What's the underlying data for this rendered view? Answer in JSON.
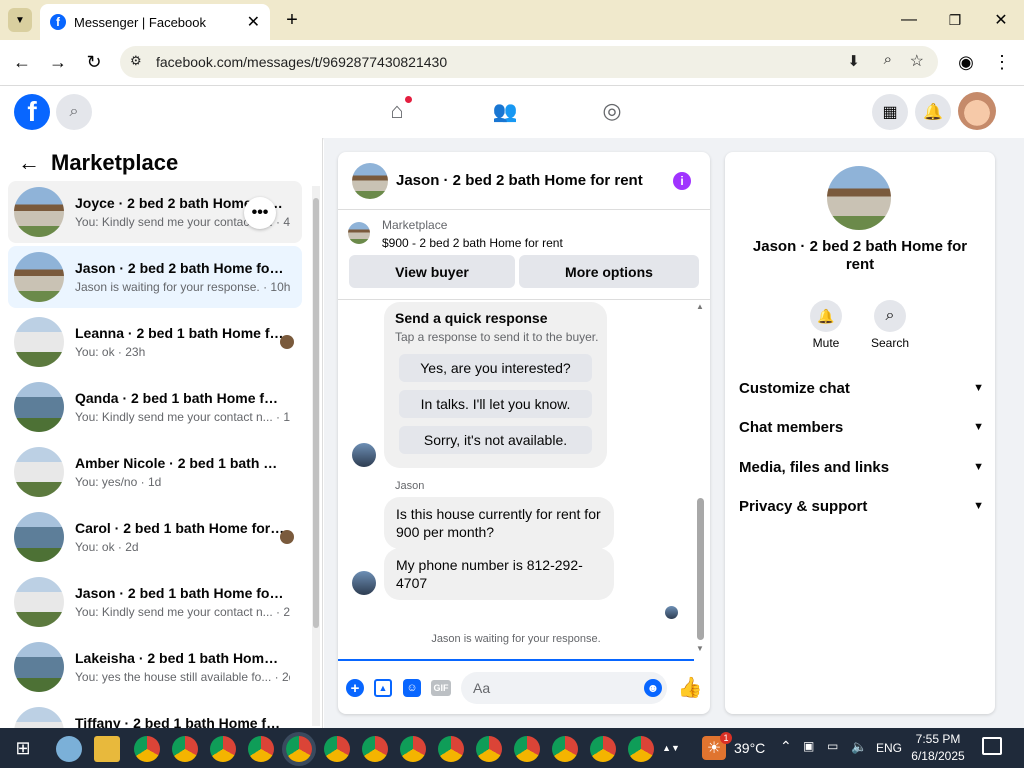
{
  "browser": {
    "tab_title": "Messenger | Facebook",
    "url": "facebook.com/messages/t/9692877430821430"
  },
  "sidebar": {
    "title": "Marketplace",
    "conversations": [
      {
        "name": "Joyce · 2 bed 2 bath Home for rent",
        "preview": "You: Kindly send me your contact n... · 4m",
        "img": "house"
      },
      {
        "name": "Jason · 2 bed 2 bath Home for rent",
        "preview": "Jason is waiting for your response. · 10h",
        "img": "house"
      },
      {
        "name": "Leanna · 2 bed 1 bath Home for rent",
        "preview": "You: ok · 23h",
        "img": "house2"
      },
      {
        "name": "Qanda · 2 bed 1 bath Home for rent",
        "preview": "You: Kindly send me your contact n... · 1d",
        "img": "house3"
      },
      {
        "name": "Amber Nicole · 2 bed 1 bath Home for rent",
        "preview": "You: yes/no · 1d",
        "img": "house2"
      },
      {
        "name": "Carol · 2 bed 1 bath Home for rent",
        "preview": "You: ok · 2d",
        "img": "house3"
      },
      {
        "name": "Jason · 2 bed 1 bath Home for rent",
        "preview": "You: Kindly send me your contact n... · 2d",
        "img": "house2"
      },
      {
        "name": "Lakeisha · 2 bed 1 bath Home for rent",
        "preview": "You: yes the house still available fo... · 2d",
        "img": "house3"
      },
      {
        "name": "Tiffany · 2 bed 1 bath Home for rent",
        "preview": "",
        "img": "house2"
      }
    ]
  },
  "chat": {
    "header_title": "Jason · 2 bed 2 bath Home for rent",
    "listing_source": "Marketplace",
    "listing_title": "$900 - 2 bed 2 bath Home for rent",
    "view_buyer": "View buyer",
    "more_options": "More options",
    "quick_title": "Send a quick response",
    "quick_sub": "Tap a response to send it to the buyer.",
    "quick_replies": [
      "Yes, are you interested?",
      "In talks. I'll let you know.",
      "Sorry, it's not available."
    ],
    "sender": "Jason",
    "messages": [
      "Is this house currently for rent for 900 per month?",
      "My phone number is 812-292-4707"
    ],
    "waiting": "Jason is waiting for your response.",
    "input_placeholder": "Aa"
  },
  "details": {
    "title": "Jason · 2 bed 2 bath Home for rent",
    "mute": "Mute",
    "search": "Search",
    "sections": [
      "Customize chat",
      "Chat members",
      "Media, files and links",
      "Privacy & support"
    ]
  },
  "taskbar": {
    "temp": "39°C",
    "lang": "ENG",
    "time": "7:55 PM",
    "date": "6/18/2025",
    "weather_badge": "1"
  },
  "colors": {
    "fb_blue": "#0866ff",
    "accent_purple": "#a033ff"
  }
}
